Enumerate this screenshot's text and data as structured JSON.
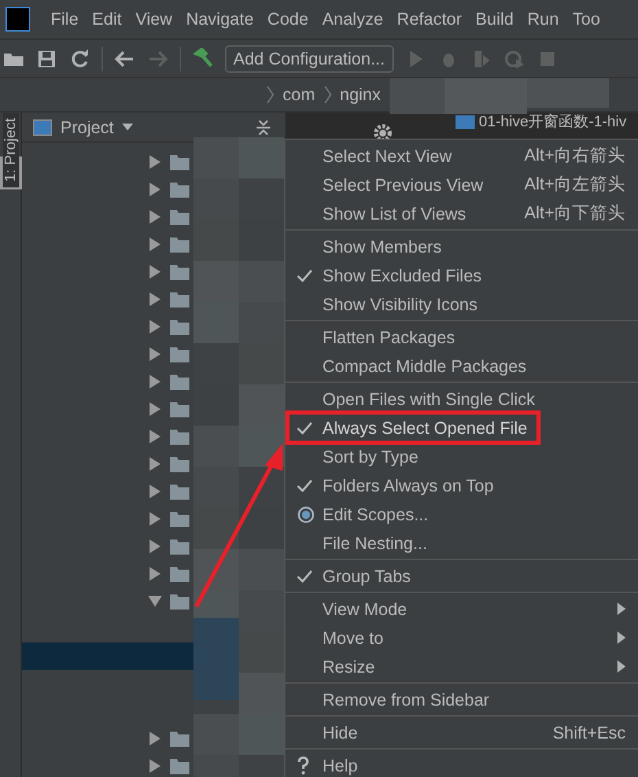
{
  "menubar": [
    "File",
    "Edit",
    "View",
    "Navigate",
    "Code",
    "Analyze",
    "Refactor",
    "Build",
    "Run",
    "Too"
  ],
  "toolbar": {
    "config_button": "Add Configuration..."
  },
  "breadcrumb": [
    "com",
    "nginx"
  ],
  "editor_tab": {
    "label": "01-hive开窗函数-1-hiv"
  },
  "tool_strip": {
    "label": "1: Project"
  },
  "project_panel": {
    "title": "Project",
    "rows": [
      {
        "kind": "folder",
        "expanded": false,
        "selected": false
      },
      {
        "kind": "folder",
        "expanded": false,
        "selected": false
      },
      {
        "kind": "folder",
        "expanded": false,
        "selected": false
      },
      {
        "kind": "folder",
        "expanded": false,
        "selected": false
      },
      {
        "kind": "folder",
        "expanded": false,
        "selected": false
      },
      {
        "kind": "folder",
        "expanded": false,
        "selected": false
      },
      {
        "kind": "folder",
        "expanded": false,
        "selected": false
      },
      {
        "kind": "folder",
        "expanded": false,
        "selected": false
      },
      {
        "kind": "folder",
        "expanded": false,
        "selected": false
      },
      {
        "kind": "folder",
        "expanded": false,
        "selected": false
      },
      {
        "kind": "folder",
        "expanded": false,
        "selected": false
      },
      {
        "kind": "folder",
        "expanded": false,
        "selected": false
      },
      {
        "kind": "folder",
        "expanded": false,
        "selected": false
      },
      {
        "kind": "folder",
        "expanded": false,
        "selected": false
      },
      {
        "kind": "folder",
        "expanded": false,
        "selected": false
      },
      {
        "kind": "folder",
        "expanded": false,
        "selected": false
      },
      {
        "kind": "folder",
        "expanded": true,
        "selected": false
      },
      {
        "kind": "blank",
        "selected": false
      },
      {
        "kind": "blank",
        "selected": true
      },
      {
        "kind": "blank",
        "selected": false
      },
      {
        "kind": "blank",
        "selected": false
      },
      {
        "kind": "folder",
        "expanded": false,
        "selected": false
      },
      {
        "kind": "folder",
        "expanded": false,
        "selected": false
      }
    ]
  },
  "menu": {
    "groups": [
      [
        {
          "kind": "item",
          "label": "Select Next View",
          "shortcut": "Alt+向右箭头",
          "checked": false,
          "submenu": false,
          "highlighted": false
        },
        {
          "kind": "item",
          "label": "Select Previous View",
          "shortcut": "Alt+向左箭头",
          "checked": false,
          "submenu": false,
          "highlighted": false
        },
        {
          "kind": "item",
          "label": "Show List of Views",
          "shortcut": "Alt+向下箭头",
          "checked": false,
          "submenu": false,
          "highlighted": false
        }
      ],
      [
        {
          "kind": "item",
          "label": "Show Members",
          "checked": false,
          "submenu": false,
          "highlighted": false
        },
        {
          "kind": "item",
          "label": "Show Excluded Files",
          "checked": true,
          "submenu": false,
          "highlighted": false
        },
        {
          "kind": "item",
          "label": "Show Visibility Icons",
          "checked": false,
          "submenu": false,
          "highlighted": false
        }
      ],
      [
        {
          "kind": "item",
          "label": "Flatten Packages",
          "checked": false,
          "submenu": false,
          "highlighted": false
        },
        {
          "kind": "item",
          "label": "Compact Middle Packages",
          "checked": false,
          "submenu": false,
          "highlighted": false
        }
      ],
      [
        {
          "kind": "item",
          "label": "Open Files with Single Click",
          "checked": false,
          "submenu": false,
          "highlighted": false
        },
        {
          "kind": "item",
          "label": "Always Select Opened File",
          "checked": true,
          "submenu": false,
          "highlighted": true
        },
        {
          "kind": "item",
          "label": "Sort by Type",
          "checked": false,
          "submenu": false,
          "highlighted": false
        },
        {
          "kind": "item",
          "label": "Folders Always on Top",
          "checked": true,
          "submenu": false,
          "highlighted": false
        },
        {
          "kind": "radio",
          "label": "Edit Scopes...",
          "submenu": false,
          "highlighted": false
        },
        {
          "kind": "item",
          "label": "File Nesting...",
          "checked": false,
          "submenu": false,
          "highlighted": false
        }
      ],
      [
        {
          "kind": "item",
          "label": "Group Tabs",
          "checked": true,
          "submenu": false,
          "highlighted": false
        }
      ],
      [
        {
          "kind": "item",
          "label": "View Mode",
          "checked": false,
          "submenu": true,
          "highlighted": false
        },
        {
          "kind": "item",
          "label": "Move to",
          "checked": false,
          "submenu": true,
          "highlighted": false
        },
        {
          "kind": "item",
          "label": "Resize",
          "checked": false,
          "submenu": true,
          "highlighted": false
        }
      ],
      [
        {
          "kind": "item",
          "label": "Remove from Sidebar",
          "checked": false,
          "submenu": false,
          "highlighted": false
        }
      ],
      [
        {
          "kind": "item",
          "label": "Hide",
          "shortcut": "Shift+Esc",
          "checked": false,
          "submenu": false,
          "highlighted": false
        }
      ],
      [
        {
          "kind": "help",
          "label": "Help",
          "submenu": false,
          "highlighted": false
        }
      ]
    ]
  }
}
